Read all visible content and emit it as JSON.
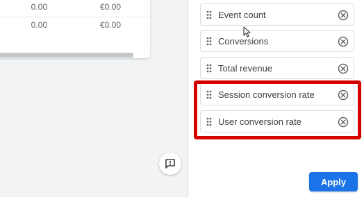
{
  "table": {
    "rows": [
      {
        "col1": "0.00",
        "col2": "€0.00"
      },
      {
        "col1": "0.00",
        "col2": "€0.00"
      }
    ]
  },
  "metrics": [
    {
      "label": "Event count"
    },
    {
      "label": "Conversions"
    },
    {
      "label": "Total revenue"
    },
    {
      "label": "Session conversion rate"
    },
    {
      "label": "User conversion rate"
    }
  ],
  "apply_label": "Apply",
  "icons": {
    "drag": "drag-handle-icon",
    "remove": "remove-circle-icon",
    "feedback": "feedback-icon",
    "cursor": "mouse-cursor"
  },
  "colors": {
    "accent": "#1a73e8",
    "highlight": "#d50000",
    "panel_bg": "#f1f3f4"
  }
}
